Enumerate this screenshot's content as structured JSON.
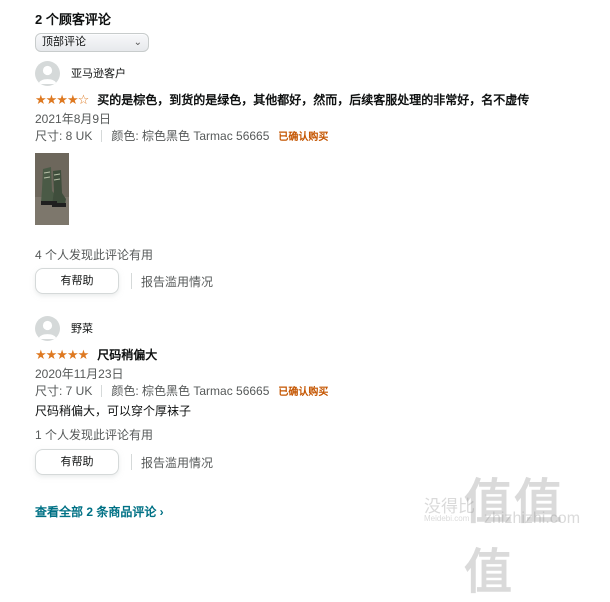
{
  "heading": "2 个顾客评论",
  "sort": {
    "selected": "顶部评论",
    "icon": "chevron-down-icon"
  },
  "reviews": [
    {
      "username": "亚马逊客户",
      "stars": 4,
      "stars_text": "★★★★☆",
      "title": "买的是棕色，到货的是绿色，其他都好，然而，后续客服处理的非常好，名不虚传",
      "date": "2021年8月9日",
      "size": "尺寸: 8 UK",
      "color": "颜色: 棕色黑色 Tarmac 56665",
      "verified": "已确认购买",
      "body": "",
      "helpful_count": "4 个人发现此评论有用",
      "helpful_button": "有帮助",
      "report": "报告滥用情况"
    },
    {
      "username": "野菜",
      "stars": 5,
      "stars_text": "★★★★★",
      "title": "尺码稍偏大",
      "date": "2020年11月23日",
      "size": "尺寸: 7 UK",
      "color": "颜色: 棕色黑色 Tarmac 56665",
      "verified": "已确认购买",
      "body": "尺码稍偏大，可以穿个厚袜子",
      "helpful_count": "1 个人发现此评论有用",
      "helpful_button": "有帮助",
      "report": "报告滥用情况"
    }
  ],
  "see_all": "查看全部 2 条商品评论 ›",
  "watermark": {
    "big": "值值值",
    "small": "没得比",
    "site": "zhizhizhi.com",
    "meitext": "Meidebi.com"
  },
  "colors": {
    "star": "#de7921",
    "verified": "#c45500",
    "link": "#007185",
    "muted": "#565959"
  }
}
